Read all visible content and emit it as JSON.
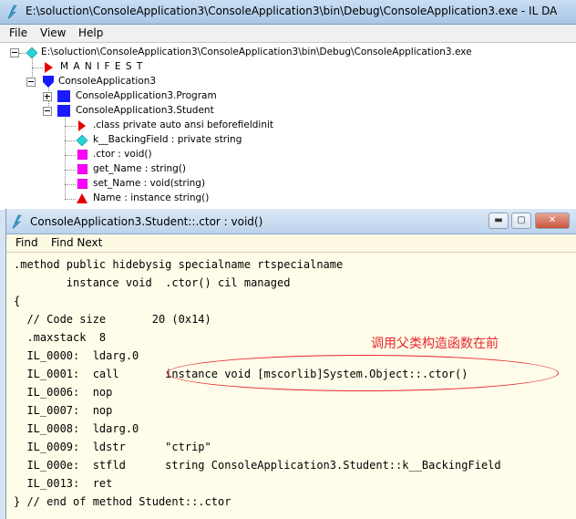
{
  "main_window": {
    "title": "E:\\soluction\\ConsoleApplication3\\ConsoleApplication3\\bin\\Debug\\ConsoleApplication3.exe - IL DA",
    "menu": [
      "File",
      "View",
      "Help"
    ]
  },
  "tree": {
    "root": "E:\\soluction\\ConsoleApplication3\\ConsoleApplication3\\bin\\Debug\\ConsoleApplication3.exe",
    "manifest": "M A N I F E S T",
    "namespace": "ConsoleApplication3",
    "program_class": "ConsoleApplication3.Program",
    "student_class": "ConsoleApplication3.Student",
    "members": [
      ".class private auto ansi beforefieldinit",
      "k__BackingField : private string",
      ".ctor : void()",
      "get_Name : string()",
      "set_Name : void(string)",
      "Name : instance string()"
    ]
  },
  "il_window": {
    "title": "ConsoleApplication3.Student::.ctor : void()",
    "menu": [
      "Find",
      "Find Next"
    ],
    "buttons": {
      "minimize": "▬",
      "maximize": "▢",
      "close": "✕"
    },
    "code_lines": [
      ".method public hidebysig specialname rtspecialname",
      "        instance void  .ctor() cil managed",
      "{",
      "  // Code size       20 (0x14)",
      "  .maxstack  8",
      "  IL_0000:  ldarg.0",
      "  IL_0001:  call       instance void [mscorlib]System.Object::.ctor()",
      "  IL_0006:  nop",
      "  IL_0007:  nop",
      "  IL_0008:  ldarg.0",
      "  IL_0009:  ldstr      \"ctrip\"",
      "  IL_000e:  stfld      string ConsoleApplication3.Student::k__BackingField",
      "  IL_0013:  ret",
      "} // end of method Student::.ctor"
    ],
    "annotation": "调用父类构造函数在前"
  },
  "colors": {
    "annotation": "#e8242c",
    "code_background": "#fffde9",
    "class_icon": "#1a1aff",
    "member_icon": "#ff00ff",
    "field_icon": "#25d5d5"
  }
}
